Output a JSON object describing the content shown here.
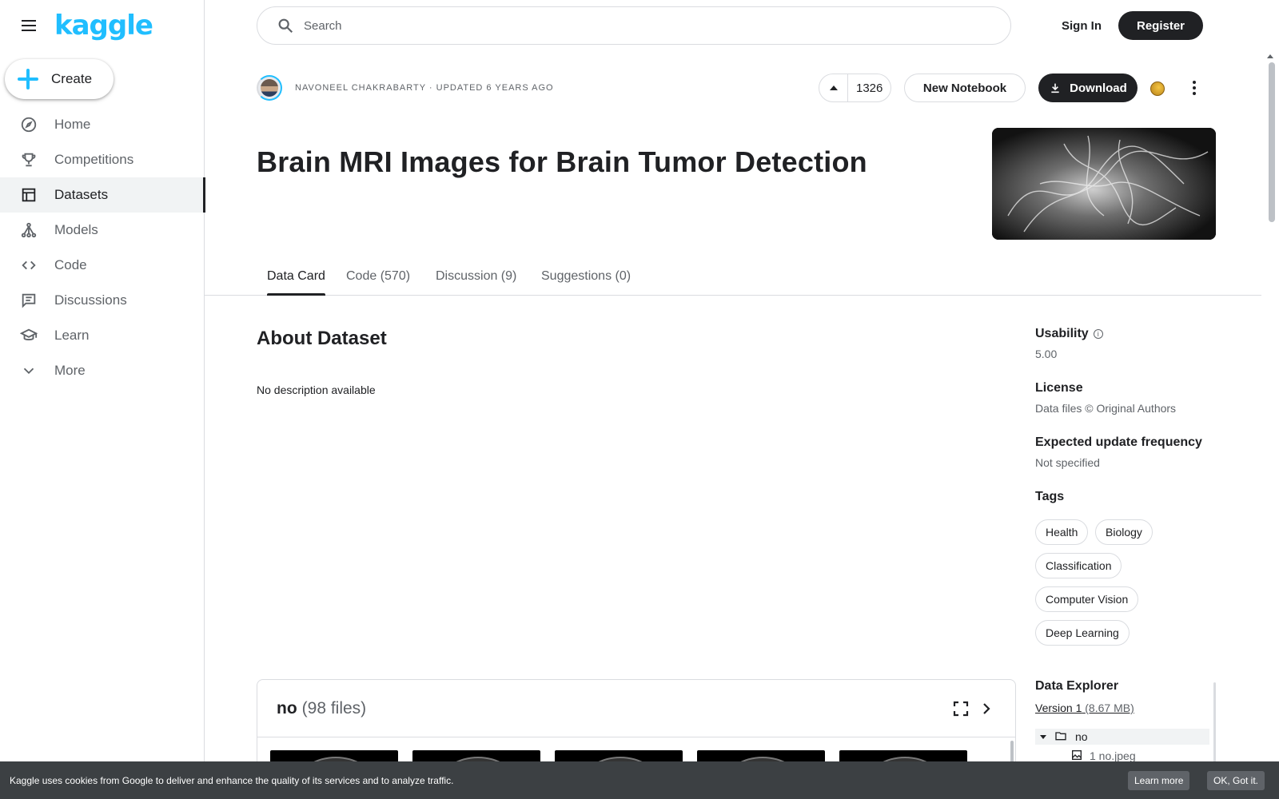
{
  "sidebar": {
    "logo": "kaggle",
    "create_label": "Create",
    "items": [
      {
        "label": "Home",
        "icon": "compass-icon"
      },
      {
        "label": "Competitions",
        "icon": "trophy-icon"
      },
      {
        "label": "Datasets",
        "icon": "table-icon",
        "active": true
      },
      {
        "label": "Models",
        "icon": "models-icon"
      },
      {
        "label": "Code",
        "icon": "code-icon"
      },
      {
        "label": "Discussions",
        "icon": "comments-icon"
      },
      {
        "label": "Learn",
        "icon": "school-icon"
      },
      {
        "label": "More",
        "icon": "chevron-down-icon"
      }
    ]
  },
  "header": {
    "search_placeholder": "Search",
    "sign_in": "Sign In",
    "register": "Register"
  },
  "dataset": {
    "author_meta": "Navoneel Chakrabarty · Updated 6 years ago",
    "votes": "1326",
    "new_notebook": "New Notebook",
    "download": "Download",
    "title": "Brain MRI Images for Brain Tumor Detection"
  },
  "tabs": [
    {
      "label": "Data Card",
      "active": true
    },
    {
      "label": "Code (570)"
    },
    {
      "label": "Discussion (9)"
    },
    {
      "label": "Suggestions (0)"
    }
  ],
  "about": {
    "heading": "About Dataset",
    "description": "No description available"
  },
  "right_panel": {
    "usability_label": "Usability",
    "usability_value": "5.00",
    "license_label": "License",
    "license_value": "Data files © Original Authors",
    "frequency_label": "Expected update frequency",
    "frequency_value": "Not specified",
    "tags_label": "Tags",
    "tags": [
      "Health",
      "Biology",
      "Classification",
      "Computer Vision",
      "Deep Learning"
    ],
    "explorer_label": "Data Explorer",
    "version_label": "Version 1",
    "version_size": "(8.67 MB)",
    "tree": [
      {
        "name": "no",
        "type": "folder"
      },
      {
        "name": "1 no.jpeg",
        "type": "file"
      }
    ]
  },
  "files_card": {
    "name": "no",
    "count": "(98 files)"
  },
  "cookie": {
    "text": "Kaggle uses cookies from Google to deliver and enhance the quality of its services and to analyze traffic.",
    "learn_more": "Learn more",
    "ok": "OK, Got it."
  }
}
